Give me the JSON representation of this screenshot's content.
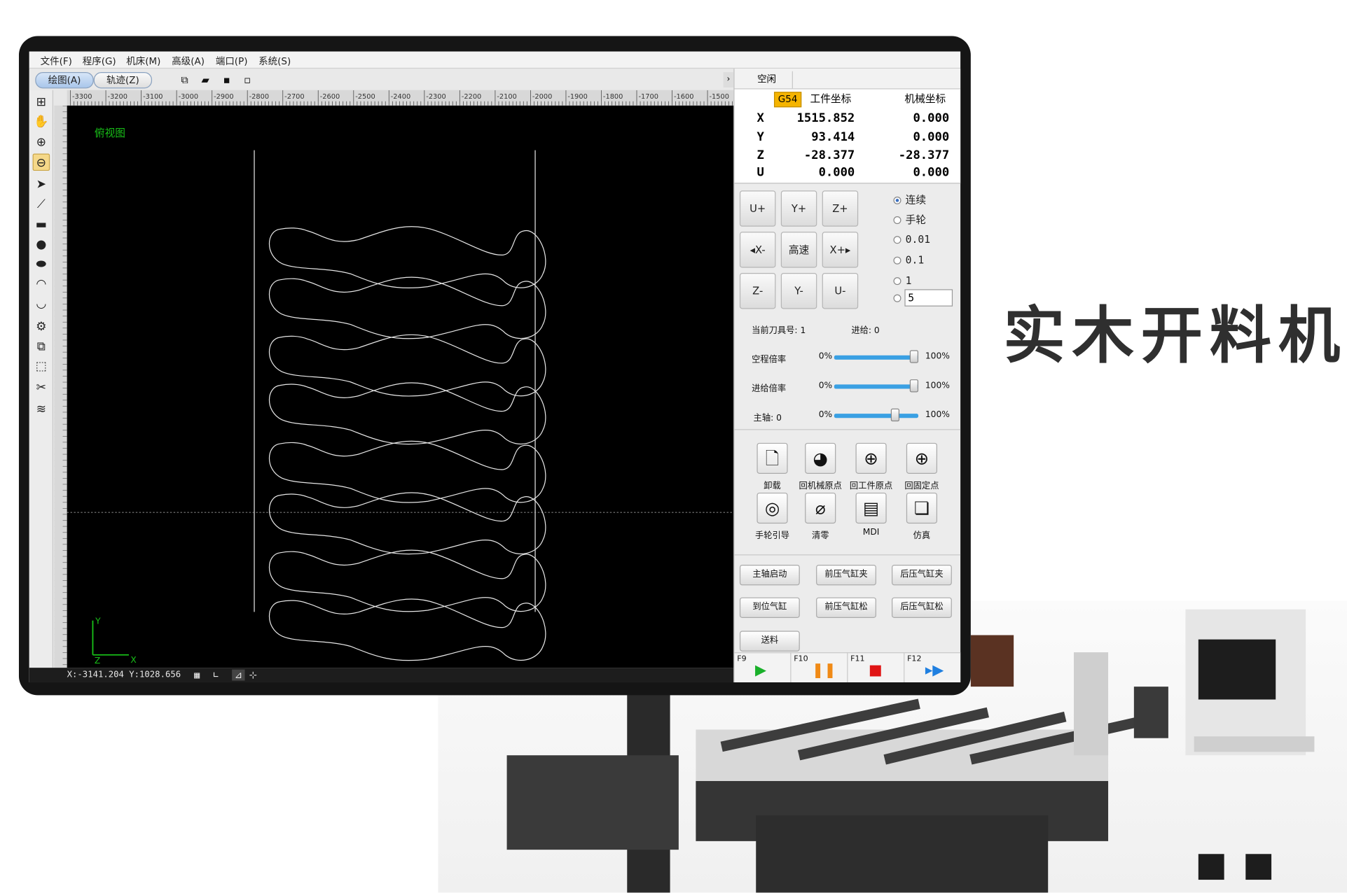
{
  "menu": [
    "文件(F)",
    "程序(G)",
    "机床(M)",
    "高级(A)",
    "端口(P)",
    "系统(S)"
  ],
  "view_tabs": {
    "draw": "绘图(A)",
    "track": "轨迹(Z)"
  },
  "ruler_labels": [
    "-3300",
    "-3200",
    "-3100",
    "-3000",
    "-2900",
    "-2800",
    "-2700",
    "-2600",
    "-2500",
    "-2400",
    "-2300",
    "-2200",
    "-2100",
    "-2000",
    "-1900",
    "-1800",
    "-1700",
    "-1600",
    "-1500"
  ],
  "canvas": {
    "view_name": "俯视图",
    "axis_y": "Y",
    "axis_x": "X",
    "axis_z": "Z"
  },
  "status": {
    "cursor": "X:-3141.204 Y:1028.656"
  },
  "state_tab": "空闲",
  "coords": {
    "coord_system": "G54",
    "work_header": "工件坐标",
    "machine_header": "机械坐标",
    "rows": [
      {
        "axis": "X",
        "work": "1515.852",
        "machine": "0.000"
      },
      {
        "axis": "Y",
        "work": "93.414",
        "machine": "0.000"
      },
      {
        "axis": "Z",
        "work": "-28.377",
        "machine": "-28.377"
      },
      {
        "axis": "U",
        "work": "0.000",
        "machine": "0.000"
      }
    ]
  },
  "jog": {
    "u_plus": "U+",
    "y_plus": "Y+",
    "z_plus": "Z+",
    "x_minus": "X-",
    "fast": "高速",
    "x_plus": "X+",
    "z_minus": "Z-",
    "y_minus": "Y-",
    "u_minus": "U-"
  },
  "step_modes": {
    "continuous": "连续",
    "handwheel": "手轮",
    "s001": "0.01",
    "s01": "0.1",
    "s1": "1",
    "custom_value": "5",
    "selected": "连续"
  },
  "tool_info": {
    "tool_label": "当前刀具号: 1",
    "feed_label": "进给: 0"
  },
  "sliders": [
    {
      "label": "空程倍率",
      "min": "0%",
      "max": "100%",
      "value": 0.95
    },
    {
      "label": "进给倍率",
      "min": "0%",
      "max": "100%",
      "value": 0.95
    },
    {
      "label": "主轴: 0",
      "min": "0%",
      "max": "100%",
      "value": 0.72
    }
  ],
  "function_buttons": {
    "unload": "卸载",
    "home_machine": "回机械原点",
    "home_work": "回工件原点",
    "home_fixed": "回固定点",
    "handwheel_guide": "手轮引导",
    "clear": "清零",
    "mdi": "MDI",
    "simulate": "仿真"
  },
  "action_buttons": {
    "spindle_start": "主轴启动",
    "front_clamp": "前压气缸夹",
    "rear_clamp": "后压气缸夹",
    "position_cyl": "到位气缸",
    "front_release": "前压气缸松",
    "rear_release": "后压气缸松",
    "feed": "送料"
  },
  "fkeys": {
    "f9": "F9",
    "f10": "F10",
    "f11": "F11",
    "f12": "F12"
  },
  "colors": {
    "run": "#19b02a",
    "pause": "#f08a16",
    "stop": "#e01414",
    "step": "#1f7fe0",
    "canvas_bg": "#000000",
    "view_label": "#18c018"
  },
  "slogan": "实木开料机"
}
